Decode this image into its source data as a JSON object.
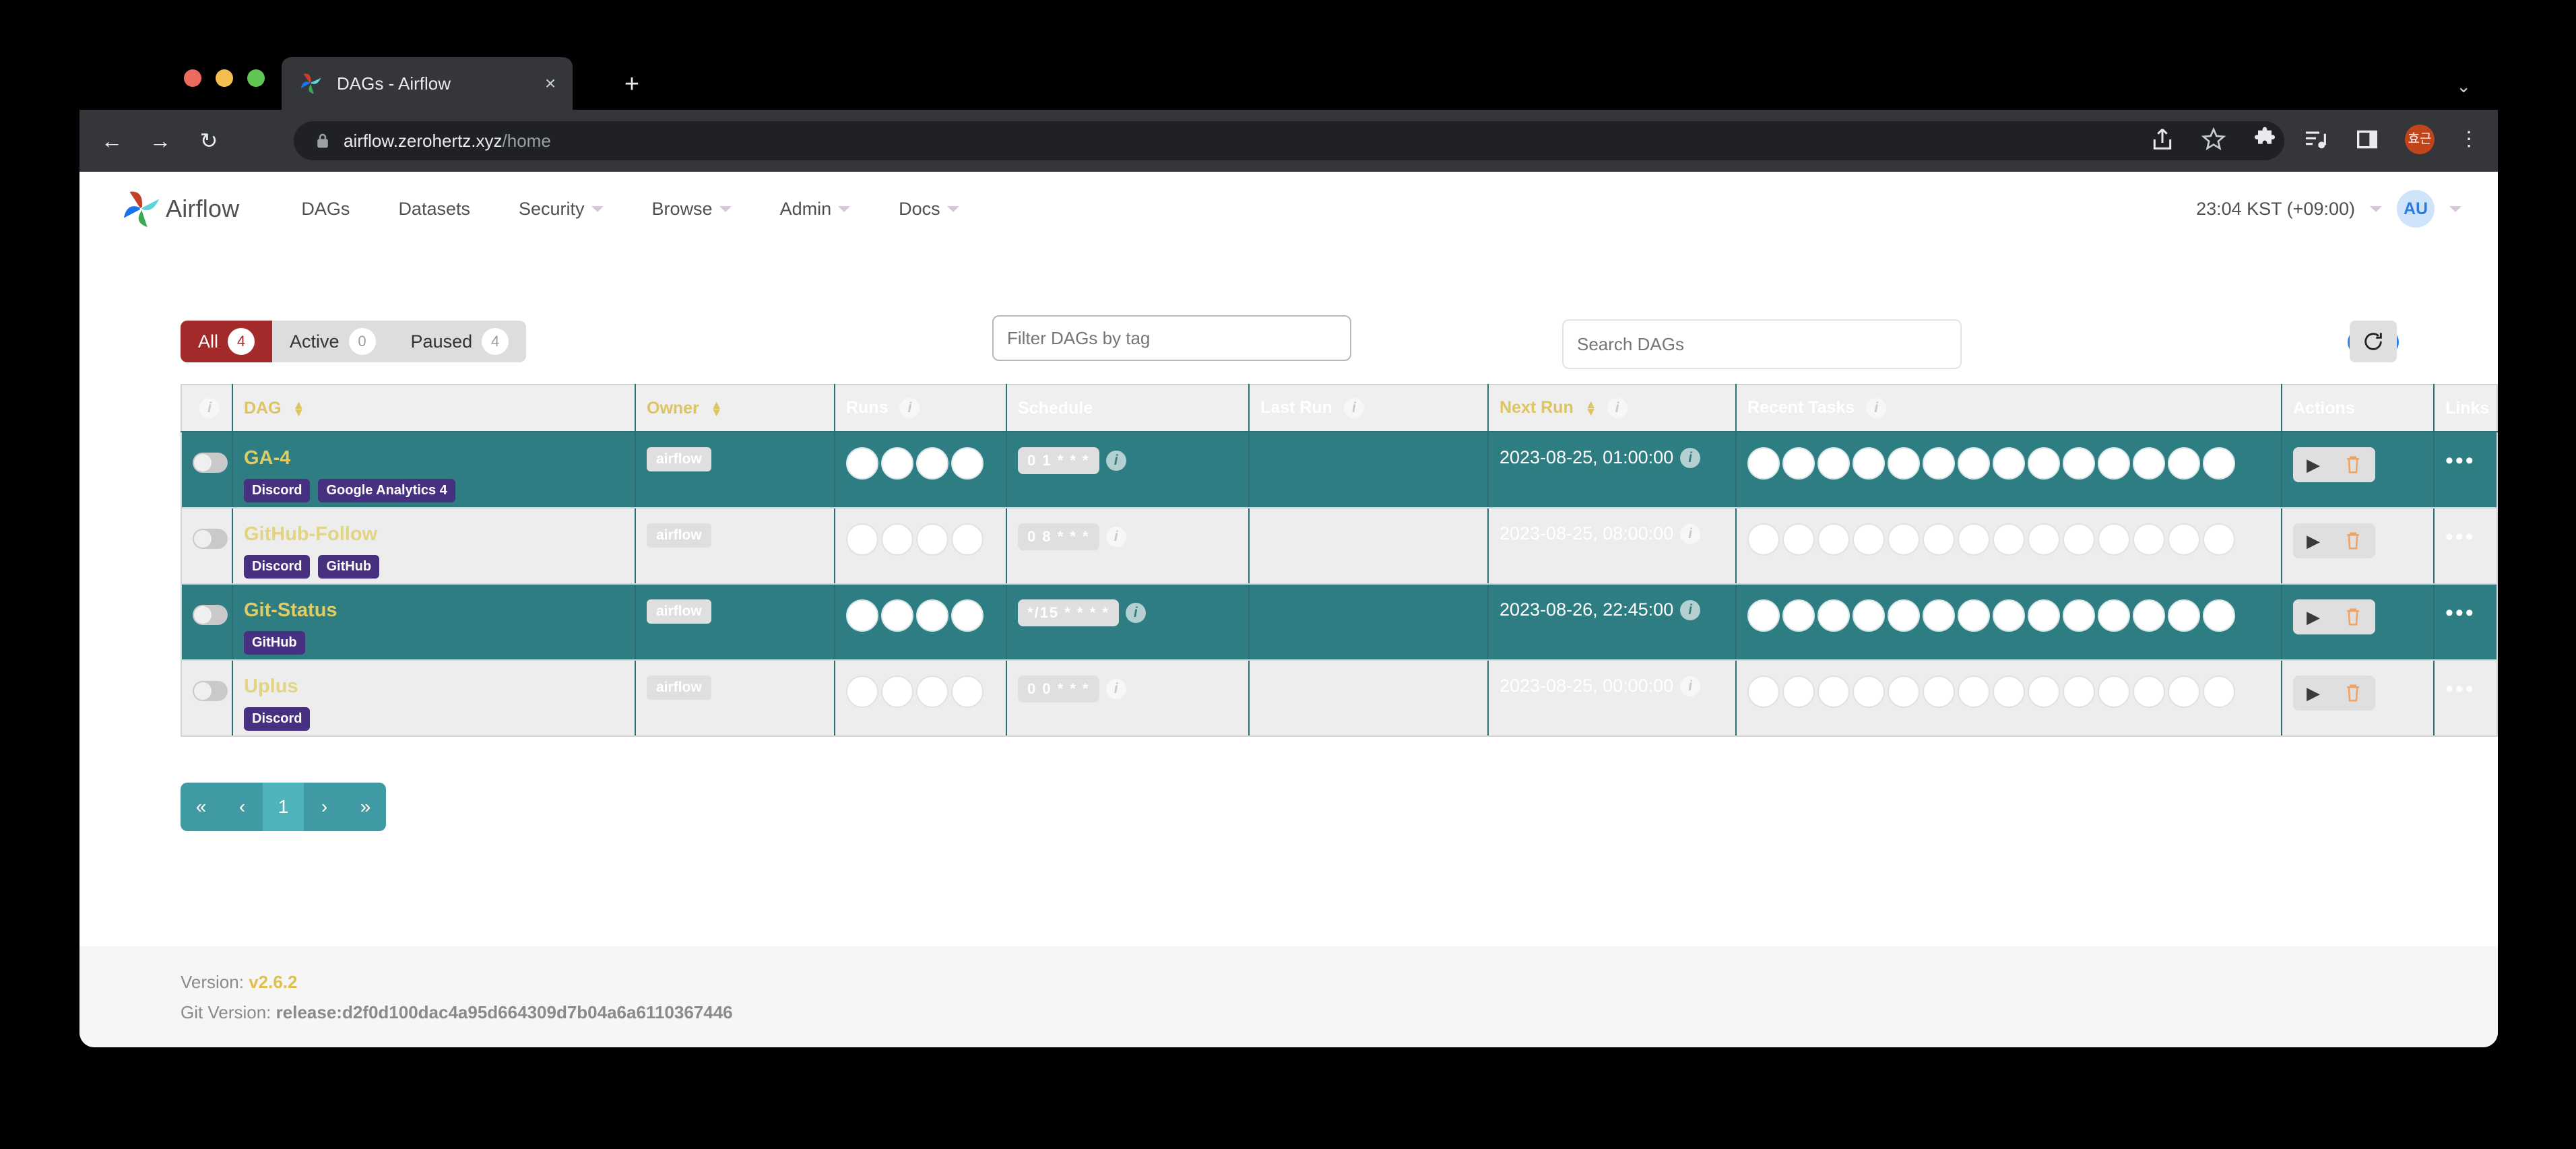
{
  "browser": {
    "tab_title": "DAGs - Airflow",
    "tab_favicon": "airflow-pinwheel-icon",
    "close_label": "×",
    "new_tab_label": "+",
    "window_chevron": "⌄",
    "back_icon": "←",
    "forward_icon": "→",
    "reload_icon": "↻",
    "url_host": "airflow.zerohertz.xyz",
    "url_path": "/home",
    "profile_initials": "효근",
    "menu_icon": "⋮",
    "share_icon": "share-icon",
    "bookmark_icon": "star-icon",
    "extensions_icon": "puzzle-icon",
    "media_icon": "media-list-icon",
    "sidepanel_icon": "side-panel-icon"
  },
  "navbar": {
    "brand": "Airflow",
    "items": [
      {
        "label": "DAGs",
        "has_caret": false
      },
      {
        "label": "Datasets",
        "has_caret": false
      },
      {
        "label": "Security",
        "has_caret": true
      },
      {
        "label": "Browse",
        "has_caret": true
      },
      {
        "label": "Admin",
        "has_caret": true
      },
      {
        "label": "Docs",
        "has_caret": true
      }
    ],
    "clock": "23:04 KST (+09:00)",
    "avatar_initials": "AU"
  },
  "filters": {
    "tabs": [
      {
        "label": "All",
        "count": "4",
        "active": true
      },
      {
        "label": "Active",
        "count": "0",
        "active": false
      },
      {
        "label": "Paused",
        "count": "4",
        "active": false
      }
    ],
    "tag_filter_placeholder": "Filter DAGs by tag",
    "tag_filter_value": "",
    "search_placeholder": "Search DAGs",
    "search_value": "",
    "auto_refresh_on": true,
    "refresh_icon": "refresh-icon"
  },
  "table": {
    "columns": [
      {
        "key": "toggle",
        "label": "",
        "sortable": false,
        "info": true,
        "gold": false
      },
      {
        "key": "dag",
        "label": "DAG",
        "sortable": true,
        "info": false,
        "gold": true
      },
      {
        "key": "owner",
        "label": "Owner",
        "sortable": true,
        "info": false,
        "gold": true
      },
      {
        "key": "runs",
        "label": "Runs",
        "sortable": false,
        "info": true,
        "gold": false
      },
      {
        "key": "sched",
        "label": "Schedule",
        "sortable": false,
        "info": false,
        "gold": false
      },
      {
        "key": "lastrun",
        "label": "Last Run",
        "sortable": false,
        "info": true,
        "gold": false
      },
      {
        "key": "nextrun",
        "label": "Next Run",
        "sortable": true,
        "info": true,
        "gold": true
      },
      {
        "key": "tasks",
        "label": "Recent Tasks",
        "sortable": false,
        "info": true,
        "gold": false
      },
      {
        "key": "actions",
        "label": "Actions",
        "sortable": false,
        "info": false,
        "gold": false
      },
      {
        "key": "links",
        "label": "Links",
        "sortable": false,
        "info": false,
        "gold": false
      }
    ],
    "rows": [
      {
        "name": "GA-4",
        "tags": [
          "Discord",
          "Google Analytics 4"
        ],
        "owner": "airflow",
        "runs_count": 4,
        "schedule": "0 1 * * *",
        "last_run": "",
        "next_run": "2023-08-25, 01:00:00",
        "tasks_count": 14,
        "highlighted": true,
        "paused": true
      },
      {
        "name": "GitHub-Follow",
        "tags": [
          "Discord",
          "GitHub"
        ],
        "owner": "airflow",
        "runs_count": 4,
        "schedule": "0 8 * * *",
        "last_run": "",
        "next_run": "2023-08-25, 08:00:00",
        "tasks_count": 14,
        "highlighted": false,
        "paused": true
      },
      {
        "name": "Git-Status",
        "tags": [
          "GitHub"
        ],
        "owner": "airflow",
        "runs_count": 4,
        "schedule": "*/15 * * * *",
        "last_run": "",
        "next_run": "2023-08-26, 22:45:00",
        "tasks_count": 14,
        "highlighted": true,
        "paused": true
      },
      {
        "name": "Uplus",
        "tags": [
          "Discord"
        ],
        "owner": "airflow",
        "runs_count": 4,
        "schedule": "0 0 * * *",
        "last_run": "",
        "next_run": "2023-08-25, 00:00:00",
        "tasks_count": 14,
        "highlighted": false,
        "paused": true
      }
    ],
    "row_action_play": "trigger-dag",
    "row_action_delete": "delete-dag",
    "row_links_label": "•••"
  },
  "pagination": {
    "first": "«",
    "prev": "‹",
    "pages": [
      "1"
    ],
    "next": "›",
    "last": "»",
    "current": "1"
  },
  "footer": {
    "version_label": "Version:",
    "version_value": "v2.6.2",
    "git_label": "Git Version:",
    "git_value": "release:d2f0d100dac4a95d664309d7b04a6a6110367446"
  },
  "colors": {
    "accent_teal": "#2E7D83",
    "row_dim": "#EDEDED",
    "tag_purple": "#473080",
    "dag_gold": "#E0CC63",
    "active_tab_red": "#A32A2A",
    "toggle_blue": "#2B7CEE",
    "trash_orange": "#EFA262",
    "pagination_teal": "#3F9AA3"
  }
}
